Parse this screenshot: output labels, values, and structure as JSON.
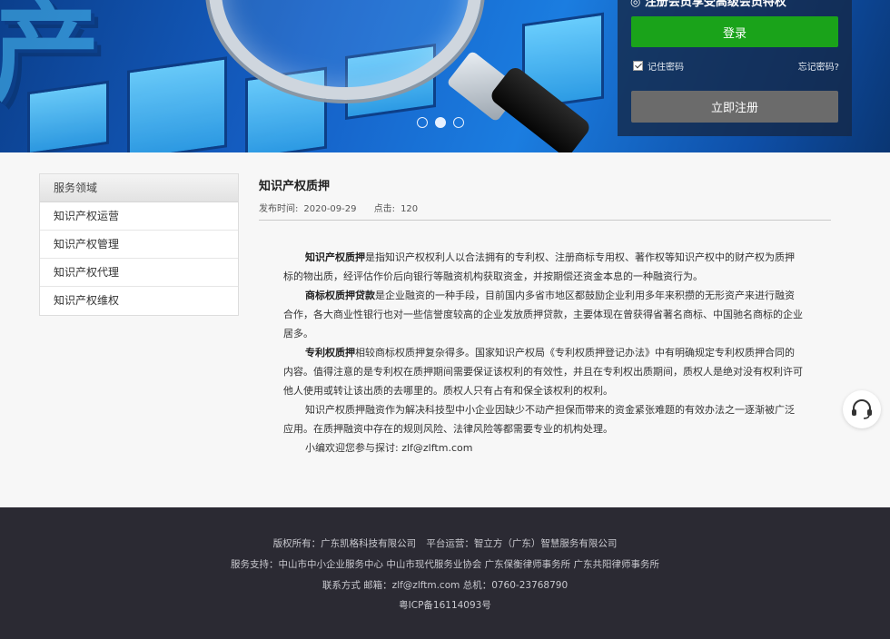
{
  "banner": {
    "login_panel_partial_text": "◎ 注册会员享受高级会员特权",
    "login_button": "登录",
    "remember_label": "记住密码",
    "forgot_label": "忘记密码?",
    "register_button": "立即注册",
    "carousel_active_index": 2,
    "carousel_count": 3
  },
  "sidebar": {
    "header": "服务领域",
    "items": [
      {
        "label": "知识产权运营"
      },
      {
        "label": "知识产权管理"
      },
      {
        "label": "知识产权代理"
      },
      {
        "label": "知识产权维权"
      }
    ]
  },
  "article": {
    "title": "知识产权质押",
    "published_label": "发布时间:",
    "published_date": "2020-09-29",
    "clicks_label": "点击:",
    "clicks": "120",
    "p1_bold": "知识产权质押",
    "p1_text": "是指知识产权权利人以合法拥有的专利权、注册商标专用权、著作权等知识产权中的财产权为质押标的物出质，经评估作价后向银行等融资机构获取资金，并按期偿还资金本息的一种融资行为。",
    "p2_bold": "商标权质押贷款",
    "p2_text": "是企业融资的一种手段，目前国内多省市地区都鼓励企业利用多年来积攒的无形资产来进行融资合作，各大商业性银行也对一些信誉度较高的企业发放质押贷款，主要体现在曾获得省著名商标、中国驰名商标的企业居多。",
    "p3_bold": "专利权质押",
    "p3_text": "相较商标权质押复杂得多。国家知识产权局《专利权质押登记办法》中有明确规定专利权质押合同的内容。值得注意的是专利权在质押期间需要保证该权利的有效性，并且在专利权出质期间，质权人是绝对没有权利许可他人使用或转让该出质的去哪里的。质权人只有占有和保全该权利的权利。",
    "p4_text": "知识产权质押融资作为解决科技型中小企业因缺少不动产担保而带来的资金紧张难题的有效办法之一逐渐被广泛应用。在质押融资中存在的规则风险、法律风险等都需要专业的机构处理。",
    "p5_text": "小编欢迎您参与探讨: zlf@zlftm.com"
  },
  "footer": {
    "copyright": "版权所有：广东凯格科技有限公司",
    "operator": "平台运营：智立方（广东）智慧服务有限公司",
    "support": "服务支持：中山市中小企业服务中心   中山市现代服务业协会   广东保衡律师事务所   广东共阳律师事务所",
    "contact": "联系方式  邮箱：zlf@zlftm.com   总机：0760-23768790",
    "icp": "粤ICP备16114093号"
  },
  "icons": {
    "service": "headset-icon",
    "check": "checkbox-checked-icon"
  },
  "colors": {
    "login_green": "#1aa31a",
    "register_gray": "#6b6b6b",
    "footer_bg": "#2b2a33"
  }
}
